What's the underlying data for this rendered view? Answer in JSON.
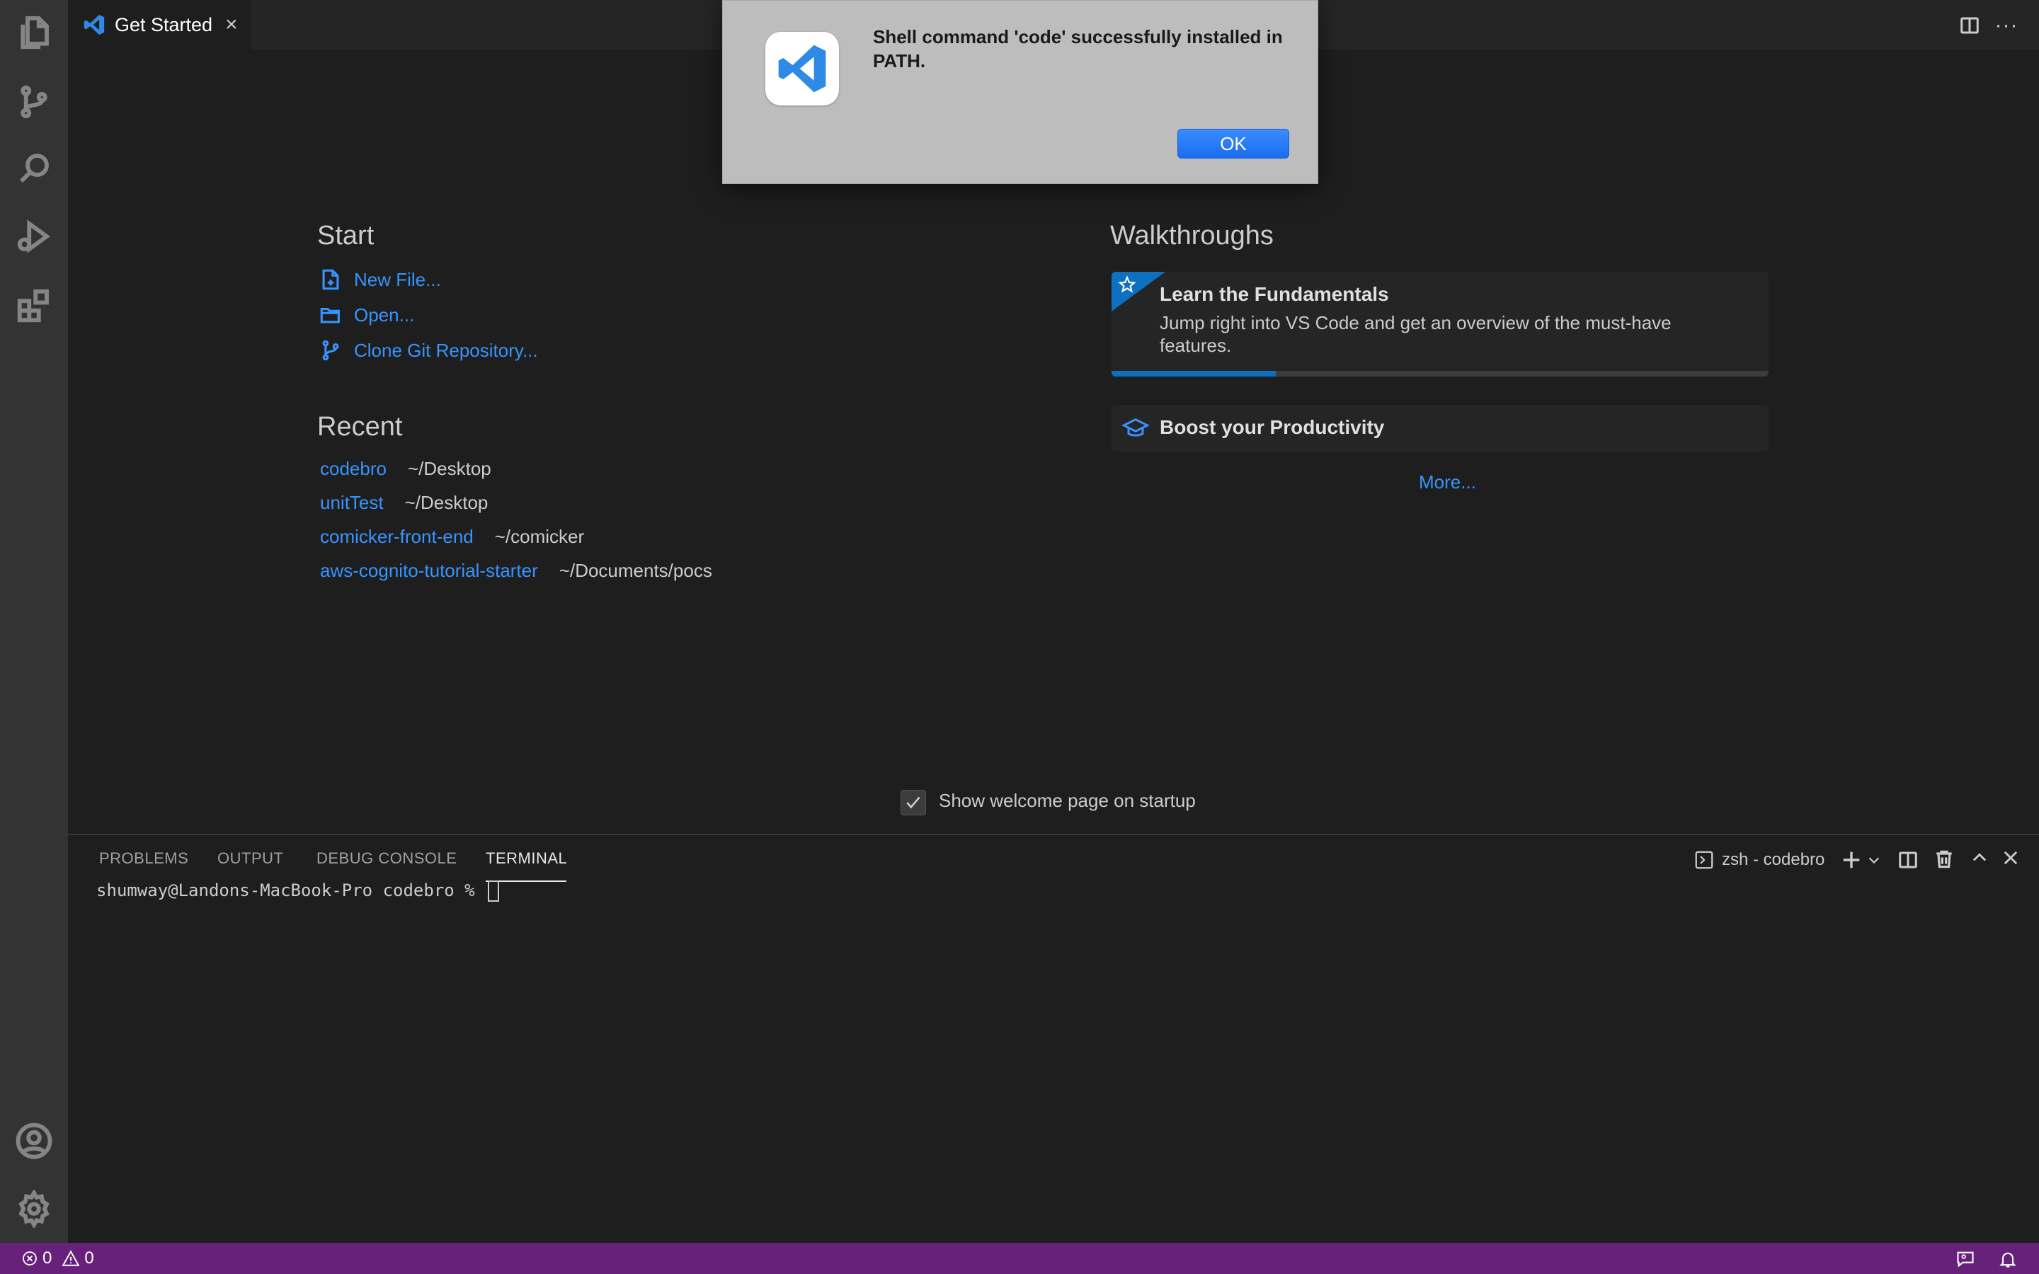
{
  "window": {
    "tab": {
      "label": "Get Started"
    }
  },
  "dialog": {
    "message": "Shell command 'code' successfully installed in PATH.",
    "ok_label": "OK"
  },
  "welcome": {
    "start": {
      "title": "Start",
      "items": [
        {
          "label": "New File...",
          "icon": "new-file-icon"
        },
        {
          "label": "Open...",
          "icon": "folder-open-icon"
        },
        {
          "label": "Clone Git Repository...",
          "icon": "git-branch-icon"
        }
      ]
    },
    "recent": {
      "title": "Recent",
      "items": [
        {
          "name": "codebro",
          "path": "~/Desktop"
        },
        {
          "name": "unitTest",
          "path": "~/Desktop"
        },
        {
          "name": "comicker-front-end",
          "path": "~/comicker"
        },
        {
          "name": "aws-cognito-tutorial-starter",
          "path": "~/Documents/pocs"
        }
      ]
    },
    "walkthroughs": {
      "title": "Walkthroughs",
      "fundamentals": {
        "title": "Learn the Fundamentals",
        "description_line1": "Jump right into VS Code and get an overview of the must-have",
        "description_line2": "features.",
        "progress": 0.25
      },
      "productivity": {
        "title": "Boost your Productivity"
      },
      "more_label": "More..."
    },
    "show_on_startup": {
      "label": "Show welcome page on startup",
      "checked": true
    }
  },
  "panel": {
    "tabs": [
      "PROBLEMS",
      "OUTPUT",
      "DEBUG CONSOLE",
      "TERMINAL"
    ],
    "active_tab": "TERMINAL",
    "terminal_name": "zsh - codebro",
    "prompt": "shumway@Landons-MacBook-Pro codebro % "
  },
  "status_bar": {
    "errors": "0",
    "warnings": "0"
  },
  "colors": {
    "accent": "#3794ff",
    "status_bar": "#68217a",
    "dialog_button": "#1a6df0"
  }
}
